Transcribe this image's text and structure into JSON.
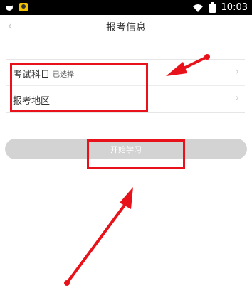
{
  "status_bar": {
    "time": "10:03",
    "left_icons": [
      "notification-app-icon",
      "avatar-notification-icon"
    ],
    "right_icons": [
      "wifi-icon",
      "battery-icon"
    ]
  },
  "nav": {
    "title": "报考信息",
    "back_icon": "chevron-left-icon"
  },
  "form": {
    "rows": [
      {
        "label": "考试科目",
        "value": "已选择",
        "icon": "chevron-right-icon"
      },
      {
        "label": "报考地区",
        "value": "",
        "icon": "chevron-right-icon"
      }
    ]
  },
  "actions": {
    "start_label": "开始学习"
  },
  "annotation": {
    "color": "#e8131a"
  },
  "colors": {
    "button": "#d3d3d3",
    "title": "#333333",
    "divider": "#e6e6e6"
  }
}
